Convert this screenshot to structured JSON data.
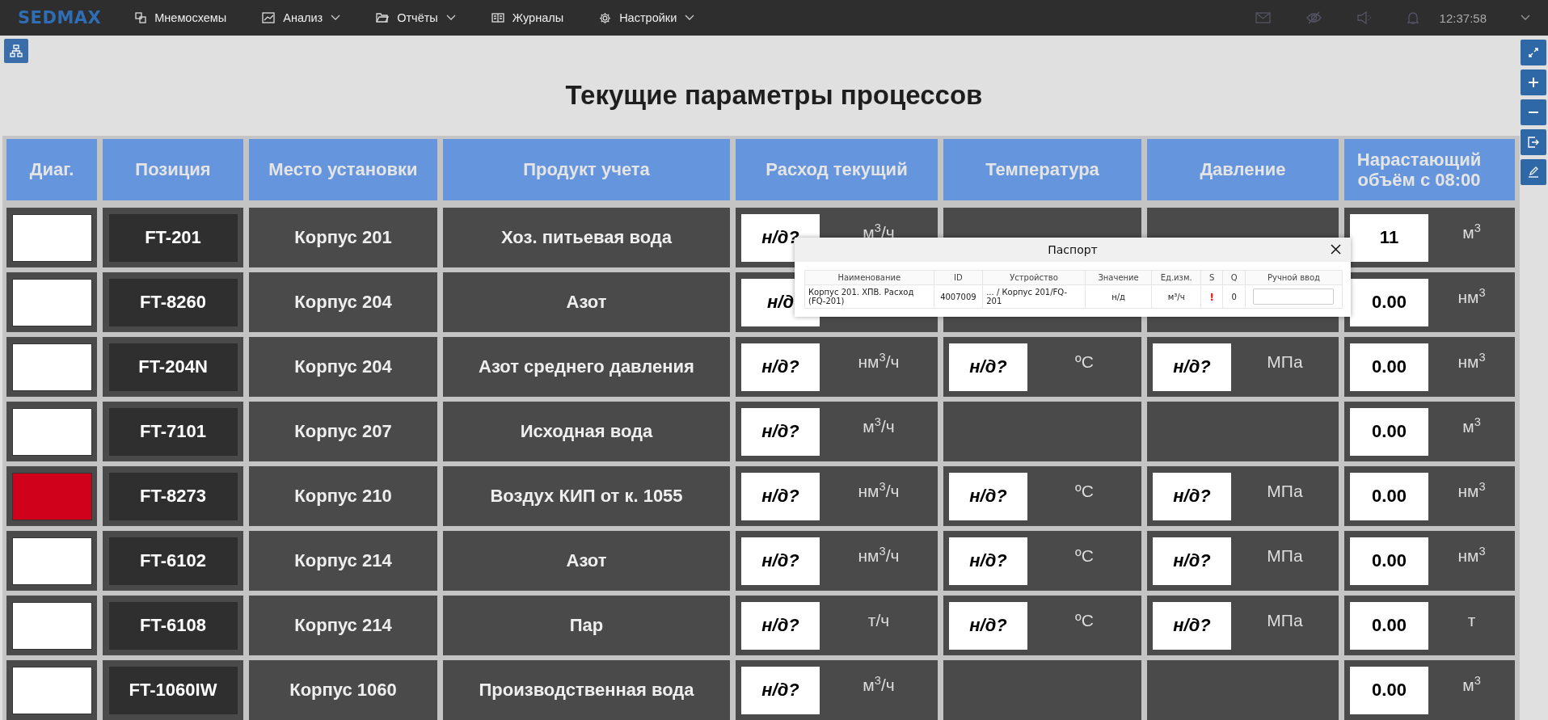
{
  "topbar": {
    "logo": "SEDMAX",
    "menu": [
      {
        "label": "Мнемосхемы",
        "dropdown": false
      },
      {
        "label": "Анализ",
        "dropdown": true
      },
      {
        "label": "Отчёты",
        "dropdown": true
      },
      {
        "label": "Журналы",
        "dropdown": false
      },
      {
        "label": "Настройки",
        "dropdown": true
      }
    ],
    "time": "12:37:58"
  },
  "title": "Текущие параметры процессов",
  "columns": [
    "Диаг.",
    "Позиция",
    "Место установки",
    "Продукт учета",
    "Расход текущий",
    "Температура",
    "Давление",
    "Нарастающий объём с 08:00"
  ],
  "rows": [
    {
      "color": "#ffffff",
      "position": "FT-201",
      "place": "Корпус 201",
      "product": "Хоз. питьевая вода",
      "flow": {
        "value": "н/д?",
        "unit": "м$^{3}$/ч"
      },
      "accumulated": {
        "value": "11",
        "unit": "м$^{3}$"
      }
    },
    {
      "color": "#ffffff",
      "position": "FT-8260",
      "place": "Корпус 204",
      "product": "Азот",
      "flow": {
        "value": "н/д"
      },
      "accumulated": {
        "value": "0.00",
        "unit": "нм$^{3}$"
      }
    },
    {
      "color": "#ffffff",
      "position": "FT-204N",
      "place": "Корпус 204",
      "product": "Азот среднего давления",
      "flow": {
        "value": "н/д?",
        "unit": "нм$^{3}$/ч"
      },
      "temperature": {
        "value": "н/д?",
        "unit": "ºC"
      },
      "pressure": {
        "value": "н/д?",
        "unit": "МПа"
      },
      "accumulated": {
        "value": "0.00",
        "unit": "нм$^{3}$"
      }
    },
    {
      "color": "#ffffff",
      "position": "FT-7101",
      "place": "Корпус 207",
      "product": "Исходная вода",
      "flow": {
        "value": "н/д?",
        "unit": "м$^{3}$/ч"
      },
      "accumulated": {
        "value": "0.00",
        "unit": "м$^{3}$"
      }
    },
    {
      "color": "#d0021b",
      "position": "FT-8273",
      "place": "Корпус 210",
      "product": "Воздух КИП от к. 1055",
      "flow": {
        "value": "н/д?",
        "unit": "нм$^{3}$/ч"
      },
      "temperature": {
        "value": "н/д?",
        "unit": "ºC"
      },
      "pressure": {
        "value": "н/д?",
        "unit": "МПа"
      },
      "accumulated": {
        "value": "0.00",
        "unit": "нм$^{3}$"
      }
    },
    {
      "color": "#ffffff",
      "position": "FT-6102",
      "place": "Корпус 214",
      "product": "Азот",
      "flow": {
        "value": "н/д?",
        "unit": "нм$^{3}$/ч"
      },
      "temperature": {
        "value": "н/д?",
        "unit": "ºC"
      },
      "pressure": {
        "value": "н/д?",
        "unit": "МПа"
      },
      "accumulated": {
        "value": "0.00",
        "unit": "нм$^{3}$"
      }
    },
    {
      "color": "#ffffff",
      "position": "FT-6108",
      "place": "Корпус 214",
      "product": "Пар",
      "flow": {
        "value": "н/д?",
        "unit": "т/ч"
      },
      "temperature": {
        "value": "н/д?",
        "unit": "ºC"
      },
      "pressure": {
        "value": "н/д?",
        "unit": "МПа"
      },
      "accumulated": {
        "value": "0.00",
        "unit": "т"
      }
    },
    {
      "color": "#ffffff",
      "position": "FT-1060IW",
      "place": "Корпус 1060",
      "product": "Производственная вода",
      "flow": {
        "value": "н/д?",
        "unit": "м$^{3}$/ч"
      },
      "accumulated": {
        "value": "0.00",
        "unit": "м$^{3}$"
      }
    }
  ],
  "passport": {
    "title": "Паспорт",
    "columns": [
      "Наименование",
      "ID",
      "Устройство",
      "Значение",
      "Ед.изм.",
      "S",
      "Q",
      "Ручной ввод"
    ],
    "rows": [
      {
        "name": "Корпус 201. ХПВ. Расход (FQ-201)",
        "id": "4007009",
        "device": "... / Корпус 201/FQ-201",
        "value": "н/д",
        "unit": "м³/ч",
        "s": "!",
        "q": "0"
      }
    ]
  }
}
